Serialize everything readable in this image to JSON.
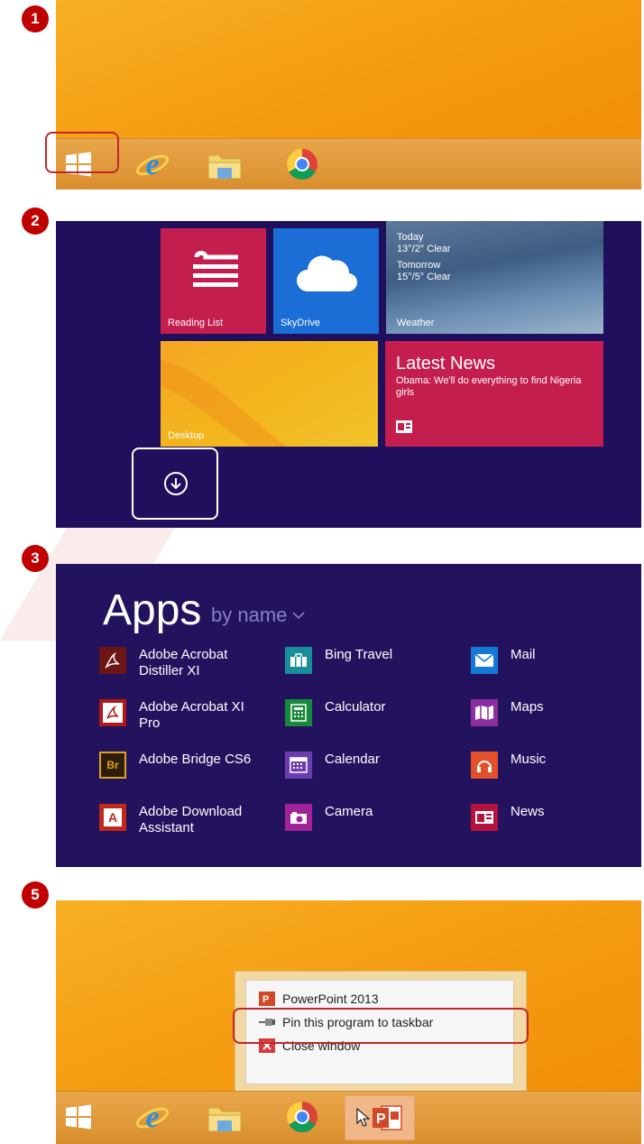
{
  "steps": {
    "s1": "1",
    "s2": "2",
    "s3": "3",
    "s5": "5"
  },
  "start_screen": {
    "reading_list": "Reading List",
    "skydrive": "SkyDrive",
    "weather": {
      "today_label": "Today",
      "today_temp": "13°/2° Clear",
      "tomorrow_label": "Tomorrow",
      "tomorrow_temp": "15°/5° Clear",
      "name": "Weather"
    },
    "desktop": "Desktop",
    "news": {
      "title": "Latest News",
      "headline": "Obama: We'll do everything to find Nigeria girls"
    }
  },
  "apps": {
    "title": "Apps",
    "sort": "by name",
    "columns": [
      [
        {
          "line1": "Adobe Acrobat",
          "line2": "Distiller XI",
          "icon": "acrobat-distiller-icon"
        },
        {
          "line1": "Adobe Acrobat XI",
          "line2": "Pro",
          "icon": "acrobat-pro-icon"
        },
        {
          "line1": "Adobe Bridge CS6",
          "line2": "",
          "icon": "bridge-icon"
        },
        {
          "line1": "Adobe Download",
          "line2": "Assistant",
          "icon": "download-assistant-icon"
        }
      ],
      [
        {
          "line1": "Bing Travel",
          "line2": "",
          "icon": "suitcase-icon"
        },
        {
          "line1": "Calculator",
          "line2": "",
          "icon": "calculator-icon"
        },
        {
          "line1": "Calendar",
          "line2": "",
          "icon": "calendar-icon"
        },
        {
          "line1": "Camera",
          "line2": "",
          "icon": "camera-icon"
        }
      ],
      [
        {
          "line1": "Mail",
          "line2": "",
          "icon": "mail-icon"
        },
        {
          "line1": "Maps",
          "line2": "",
          "icon": "maps-icon"
        },
        {
          "line1": "Music",
          "line2": "",
          "icon": "music-icon"
        },
        {
          "line1": "News",
          "line2": "",
          "icon": "news-icon"
        }
      ]
    ]
  },
  "context_menu": {
    "app_name": "PowerPoint 2013",
    "pin": "Pin this program to taskbar",
    "close": "Close window"
  },
  "colors": {
    "highlight": "#c1272d",
    "start_bg": "#1f0f5d",
    "apps_bg": "#23135e",
    "desktop": "#f59c12"
  }
}
